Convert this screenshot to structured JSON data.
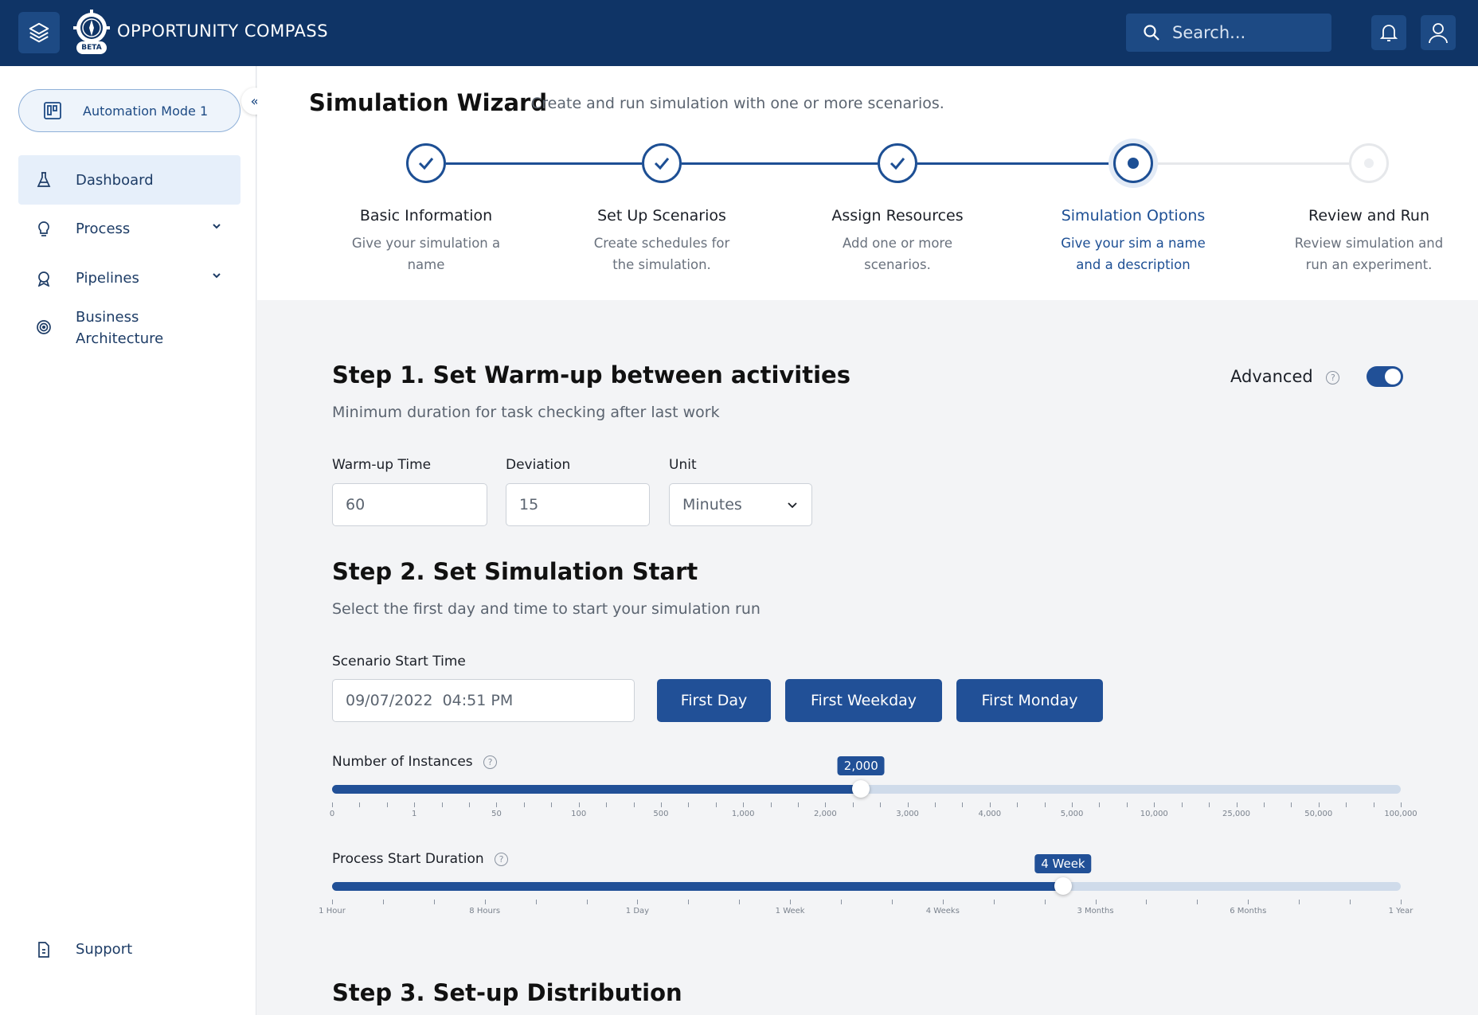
{
  "header": {
    "app_title": "OPPORTUNITY COMPASS",
    "logo_badge": "BETA",
    "search_placeholder": "Search..."
  },
  "sidebar": {
    "mode_label": "Automation Mode 1",
    "items": [
      {
        "label": "Dashboard",
        "icon": "flask-icon",
        "active": true
      },
      {
        "label": "Process",
        "icon": "lightbulb-icon",
        "expandable": true
      },
      {
        "label": "Pipelines",
        "icon": "rocket-icon",
        "expandable": true
      },
      {
        "label": "Business Architecture",
        "icon": "target-icon"
      }
    ],
    "support_label": "Support"
  },
  "wizard": {
    "title": "Simulation Wizard",
    "subtitle": "Create and run simulation with one or more scenarios.",
    "steps": [
      {
        "label": "Basic Information",
        "desc": "Give your simulation a name",
        "state": "done"
      },
      {
        "label": "Set Up Scenarios",
        "desc": "Create schedules for the simulation.",
        "state": "done"
      },
      {
        "label": "Assign Resources",
        "desc": "Add one or more scenarios.",
        "state": "done"
      },
      {
        "label": "Simulation Options",
        "desc": "Give your sim a name and a description",
        "state": "current"
      },
      {
        "label": "Review and Run",
        "desc": "Review simulation and run an experiment.",
        "state": "pending"
      }
    ]
  },
  "step1": {
    "title": "Step 1. Set Warm-up between activities",
    "subtitle": "Minimum duration for task checking after last work",
    "advanced_label": "Advanced",
    "advanced_on": true,
    "warmup_label": "Warm-up Time",
    "warmup_value": "60",
    "deviation_label": "Deviation",
    "deviation_value": "15",
    "unit_label": "Unit",
    "unit_value": "Minutes"
  },
  "step2": {
    "title": "Step 2. Set Simulation Start",
    "subtitle": "Select the first day and time to start your simulation run",
    "start_time_label": "Scenario Start Time",
    "start_time_value": "09/07/2022  04:51 PM",
    "buttons": [
      "First Day",
      "First Weekday",
      "First Monday"
    ],
    "instances": {
      "label": "Number of Instances",
      "value_label": "2,000",
      "fraction": 0.495,
      "tick_labels": [
        "0",
        "1",
        "50",
        "100",
        "500",
        "1,000",
        "2,000",
        "3,000",
        "4,000",
        "5,000",
        "10,000",
        "25,000",
        "50,000",
        "100,000"
      ]
    },
    "duration": {
      "label": "Process Start Duration",
      "value_label": "4 Week",
      "fraction": 0.684,
      "tick_labels": [
        "1 Hour",
        "8 Hours",
        "1 Day",
        "1 Week",
        "4 Weeks",
        "3 Months",
        "6 Months",
        "1 Year"
      ]
    }
  },
  "step3": {
    "title": "Step 3. Set-up Distribution"
  }
}
